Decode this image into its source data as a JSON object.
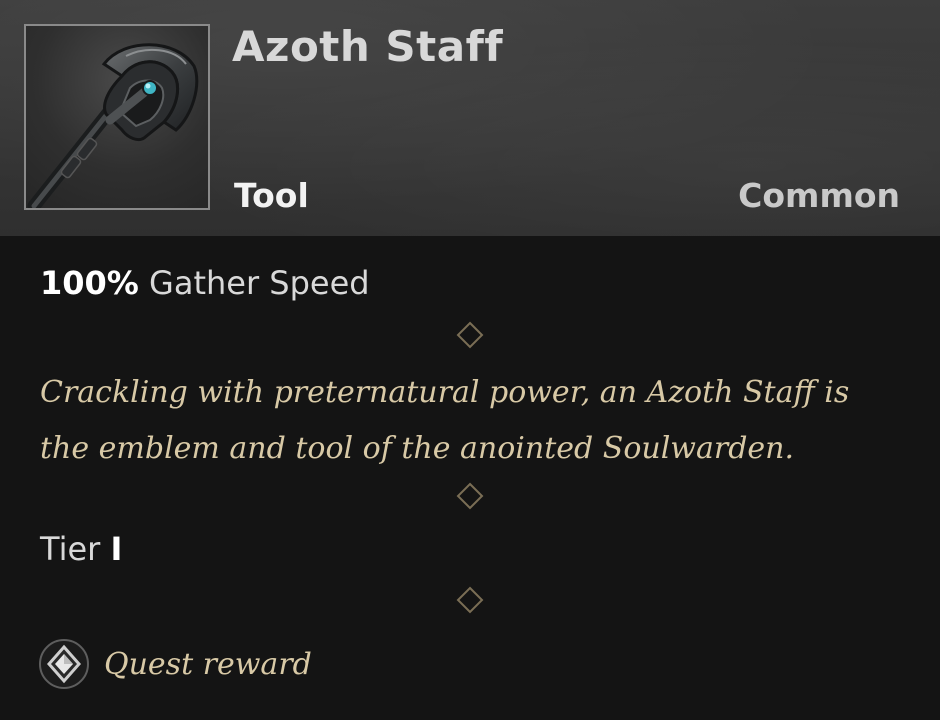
{
  "item": {
    "name": "Azoth Staff",
    "type": "Tool",
    "rarity": "Common",
    "icon": "azoth-staff-icon"
  },
  "stats": {
    "gather_value": "100%",
    "gather_label": "Gather Speed"
  },
  "description": {
    "line1": "Crackling with preternatural power, an Azoth Staff is",
    "line2": "the emblem and tool of the anointed Soulwarden."
  },
  "tier": {
    "label": "Tier",
    "value": "I"
  },
  "source": {
    "label": "Quest reward",
    "icon": "quest-reward-icon"
  },
  "colors": {
    "header_bg": "#383838",
    "body_bg": "#141414",
    "flavor_text": "#d8c9a6",
    "divider": "#5a5140"
  }
}
